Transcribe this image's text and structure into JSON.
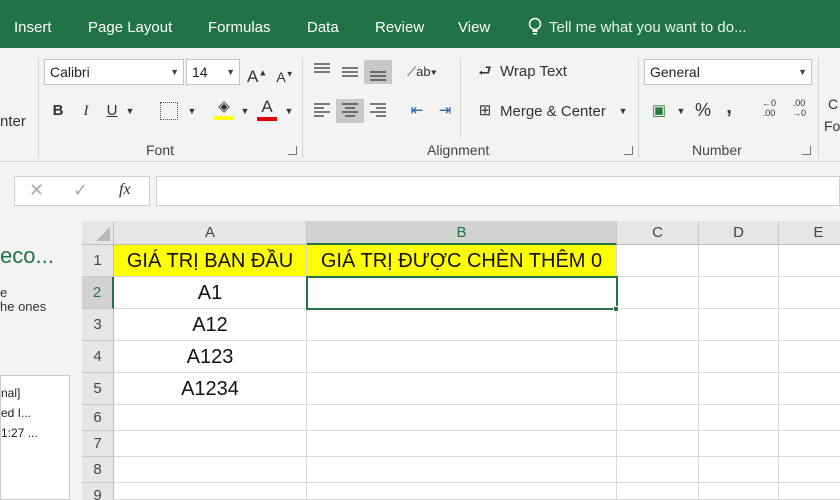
{
  "tabs": [
    "Insert",
    "Page Layout",
    "Formulas",
    "Data",
    "Review",
    "View"
  ],
  "tell_me": "Tell me what you want to do...",
  "font": {
    "name": "Calibri",
    "size": "14",
    "group_label": "Font"
  },
  "alignment": {
    "wrap_text": "Wrap Text",
    "merge_center": "Merge & Center",
    "group_label": "Alignment"
  },
  "number": {
    "format": "General",
    "percent": "%",
    "comma": ",",
    "group_label": "Number"
  },
  "clipped_left": {
    "ribbon_text": "nter",
    "panel_title": "eco...",
    "panel_line1": "e",
    "panel_line2": "he ones",
    "list1": "nal]",
    "list2": "ed I...",
    "list3": "1:27 ..."
  },
  "clipped_right": {
    "line1": "C",
    "line2": "Fo"
  },
  "formula_bar": {
    "fx": "fx",
    "value": ""
  },
  "columns": [
    "A",
    "B",
    "C",
    "D",
    "E"
  ],
  "rows": [
    "1",
    "2",
    "3",
    "4",
    "5",
    "6",
    "7",
    "8",
    "9"
  ],
  "cells": {
    "A1": "GIÁ TRỊ BAN ĐẦU",
    "B1": "GIÁ TRỊ ĐƯỢC CHÈN THÊM 0",
    "A2": "A1",
    "A3": "A12",
    "A4": "A123",
    "A5": "A1234"
  },
  "colors": {
    "excel_green": "#217346",
    "header_yellow": "#ffff00",
    "selection_green": "#217346"
  }
}
